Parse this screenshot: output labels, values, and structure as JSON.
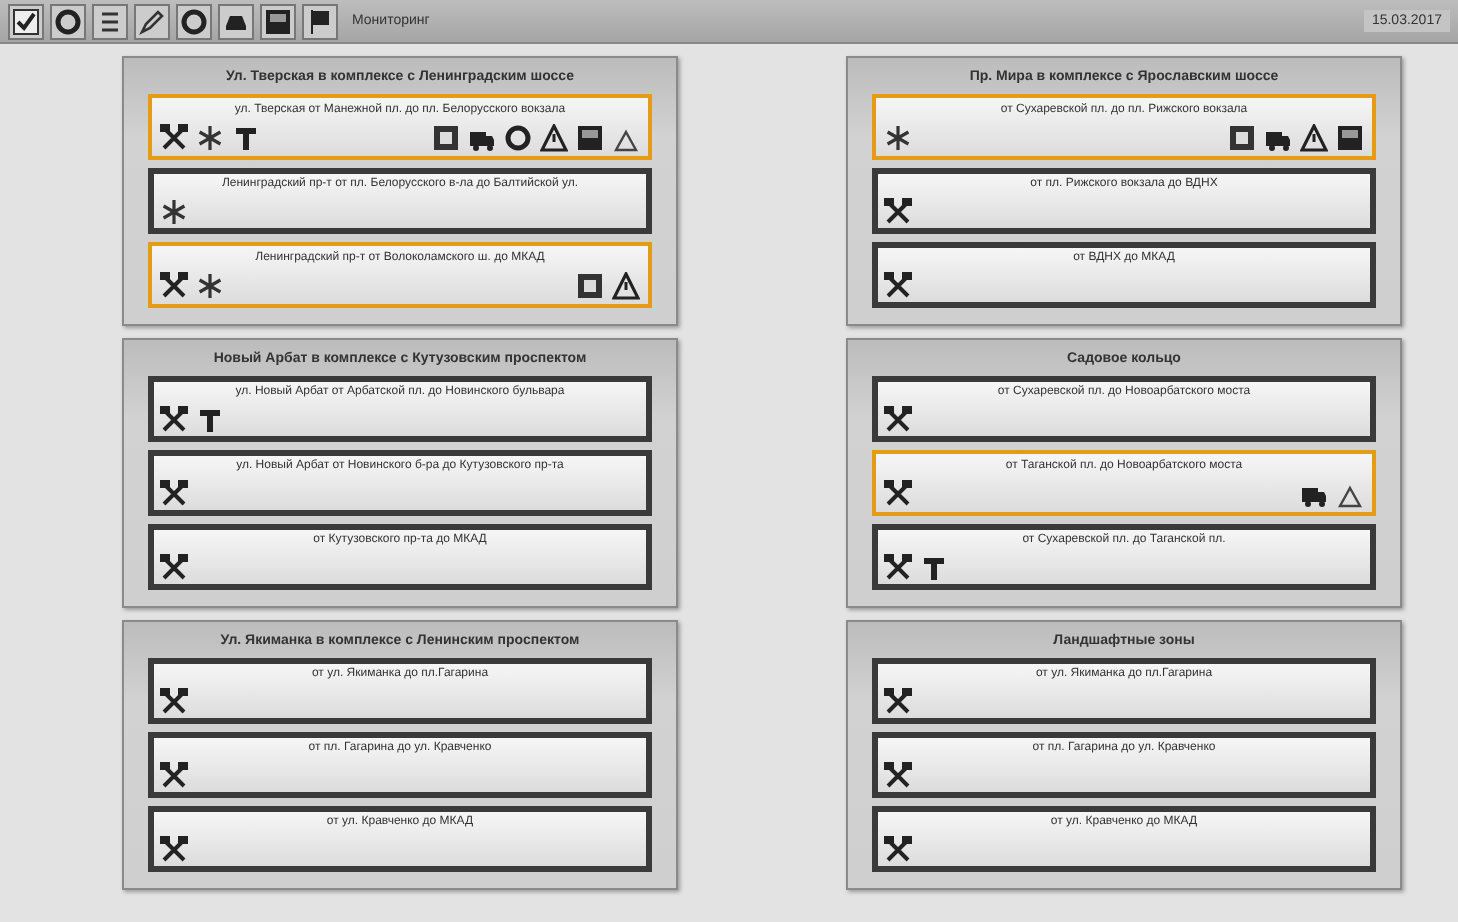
{
  "toolbar": {
    "buttons": [
      {
        "kind": "check"
      },
      {
        "kind": "refresh"
      },
      {
        "kind": "list"
      },
      {
        "kind": "edit"
      },
      {
        "kind": "circle"
      },
      {
        "kind": "car"
      },
      {
        "kind": "square"
      },
      {
        "kind": "flag"
      }
    ],
    "label": "Мониторинг",
    "date": "15.03.2017"
  },
  "panels": [
    {
      "title": "Ул. Тверская в комплексе с Ленинградским шоссе",
      "sections": [
        {
          "name": "ул. Тверская от Манежной пл. до пл. Белорусского вокзала",
          "highlighted": true,
          "icons": [
            {
              "kind": "tools"
            },
            {
              "kind": "snow"
            },
            {
              "kind": "tbar"
            }
          ],
          "status": [
            {
              "kind": "sign"
            },
            {
              "kind": "truck"
            },
            {
              "kind": "circle"
            },
            {
              "kind": "warning"
            },
            {
              "kind": "square"
            },
            {
              "kind": "small-warning"
            }
          ]
        },
        {
          "name": "Ленинградский пр-т от пл. Белорусского в-ла до Балтийской ул.",
          "highlighted": false,
          "icons": [
            {
              "kind": "snow"
            }
          ]
        },
        {
          "name": "Ленинградский пр-т от Волоколамского ш. до МКАД",
          "highlighted": true,
          "icons": [
            {
              "kind": "tools"
            },
            {
              "kind": "snow"
            }
          ],
          "status": [
            {
              "kind": "sign"
            },
            {
              "kind": "warning"
            }
          ]
        }
      ]
    },
    {
      "title": "Пр. Мира в комплексе с Ярославским шоссе",
      "sections": [
        {
          "name": "от Сухаревской пл. до пл. Рижского вокзала",
          "highlighted": true,
          "icons": [
            {
              "kind": "snow"
            }
          ],
          "status": [
            {
              "kind": "sign"
            },
            {
              "kind": "truck"
            },
            {
              "kind": "warning"
            },
            {
              "kind": "square"
            }
          ]
        },
        {
          "name": "от пл. Рижского вокзала до ВДНХ",
          "highlighted": false,
          "icons": [
            {
              "kind": "tools"
            }
          ]
        },
        {
          "name": "от ВДНХ до МКАД",
          "highlighted": false,
          "icons": [
            {
              "kind": "tools"
            }
          ]
        }
      ]
    },
    {
      "title": "Новый Арбат в комплексе с Кутузовским проспектом",
      "sections": [
        {
          "name": "ул. Новый Арбат от Арбатской пл. до Новинского бульвара",
          "highlighted": false,
          "icons": [
            {
              "kind": "tools"
            },
            {
              "kind": "tbar"
            }
          ]
        },
        {
          "name": "ул. Новый Арбат от Новинского б-ра до Кутузовского пр-та",
          "highlighted": false,
          "icons": [
            {
              "kind": "tools"
            }
          ]
        },
        {
          "name": "от Кутузовского пр-та до МКАД",
          "highlighted": false,
          "icons": [
            {
              "kind": "tools"
            }
          ]
        }
      ]
    },
    {
      "title": "Садовое кольцо",
      "sections": [
        {
          "name": "от Сухаревской пл. до Новоарбатского моста",
          "highlighted": false,
          "icons": [
            {
              "kind": "tools"
            }
          ]
        },
        {
          "name": "от Таганской пл. до Новоарбатского моста",
          "highlighted": true,
          "icons": [
            {
              "kind": "tools"
            }
          ],
          "status": [
            {
              "kind": "truck"
            },
            {
              "kind": "small-warning"
            }
          ]
        },
        {
          "name": "от Сухаревской пл. до Таганской пл.",
          "highlighted": false,
          "icons": [
            {
              "kind": "tools"
            },
            {
              "kind": "tbar"
            }
          ]
        }
      ]
    },
    {
      "title": "Ул. Якиманка в комплексе с Ленинским проспектом",
      "sections": [
        {
          "name": "от ул. Якиманка до пл.Гагарина",
          "highlighted": false,
          "icons": [
            {
              "kind": "tools"
            }
          ]
        },
        {
          "name": "от пл. Гагарина до ул. Кравченко",
          "highlighted": false,
          "icons": [
            {
              "kind": "tools"
            }
          ]
        },
        {
          "name": "от ул. Кравченко до МКАД",
          "highlighted": false,
          "icons": [
            {
              "kind": "tools"
            }
          ]
        }
      ]
    },
    {
      "title": "Ландшафтные зоны",
      "sections": [
        {
          "name": "от ул. Якиманка до пл.Гагарина",
          "highlighted": false,
          "icons": [
            {
              "kind": "tools"
            }
          ]
        },
        {
          "name": "от пл. Гагарина до ул. Кравченко",
          "highlighted": false,
          "icons": [
            {
              "kind": "tools"
            }
          ]
        },
        {
          "name": "от ул. Кравченко до МКАД",
          "highlighted": false,
          "icons": [
            {
              "kind": "tools"
            }
          ]
        }
      ]
    }
  ]
}
